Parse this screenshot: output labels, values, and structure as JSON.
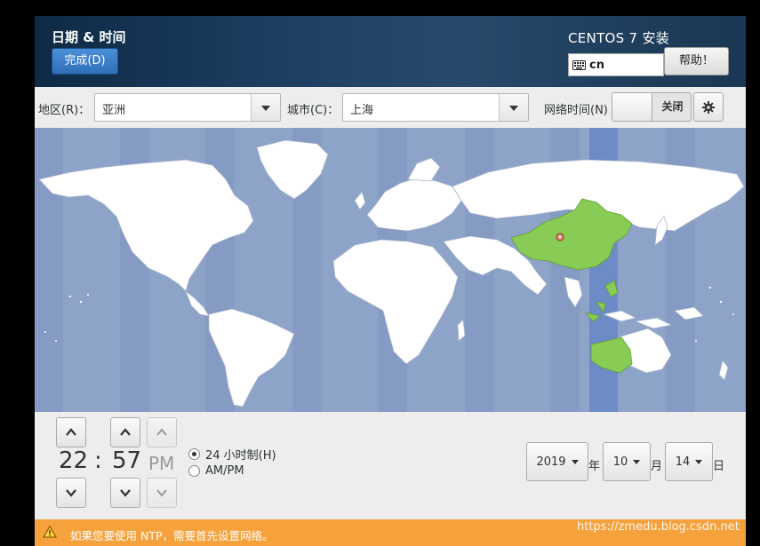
{
  "header": {
    "title": "日期 & 时间",
    "done_label": "完成(D)",
    "product": "CENTOS 7 安装",
    "keyboard_layout": "cn",
    "help_label": "帮助！"
  },
  "toolbar": {
    "region_label": "地区(R)：",
    "region_value": "亚洲",
    "city_label": "城市(C)：",
    "city_value": "上海",
    "ntp_label": "网络时间(N)",
    "ntp_state": "关闭"
  },
  "time": {
    "hours": "22",
    "separator": ":",
    "minutes": "57",
    "ampm": "PM",
    "format_24h_label": "24 小时制(H)",
    "format_ampm_label": "AM/PM",
    "selected_format": "24h"
  },
  "date": {
    "year": "2019",
    "year_label": "年",
    "month": "10",
    "month_label": "月",
    "day": "14",
    "day_label": "日"
  },
  "warning": {
    "text": "如果您要使用 NTP，需要首先设置网络。"
  },
  "watermark": "https://zmedu.blog.csdn.net",
  "colors": {
    "header_bg": "#1d3f62",
    "map_ocean": "#8ea3c8",
    "selected_region": "#88cc55",
    "warning_bg": "#f5a23d",
    "done_button": "#3d7fc9"
  }
}
